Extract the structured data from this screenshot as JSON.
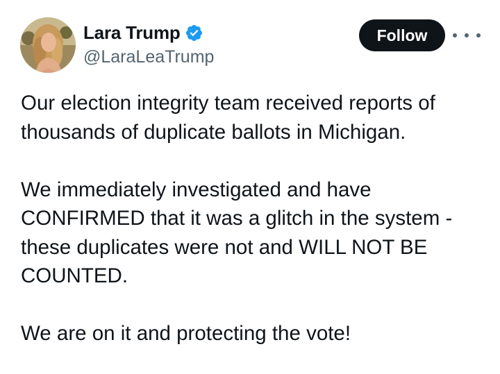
{
  "author": {
    "display_name": "Lara Trump",
    "handle": "@LaraLeaTrump",
    "verified": true,
    "avatar_icon": "profile-photo",
    "verified_icon": "verified-badge-icon",
    "verified_color": "#1d9bf0"
  },
  "actions": {
    "follow_label": "Follow",
    "more_icon": "more-options-icon"
  },
  "tweet": {
    "paragraphs": [
      "Our election integrity team received reports of\nthousands of duplicate ballots in Michigan.",
      "We immediately investigated and have\nCONFIRMED that it was a glitch in the system -\nthese duplicates were not and WILL NOT BE\nCOUNTED.",
      "We are on it and protecting the vote!"
    ]
  },
  "colors": {
    "text_primary": "#0f1419",
    "text_secondary": "#536471",
    "follow_button_bg": "#0f1419",
    "follow_button_text": "#ffffff"
  }
}
